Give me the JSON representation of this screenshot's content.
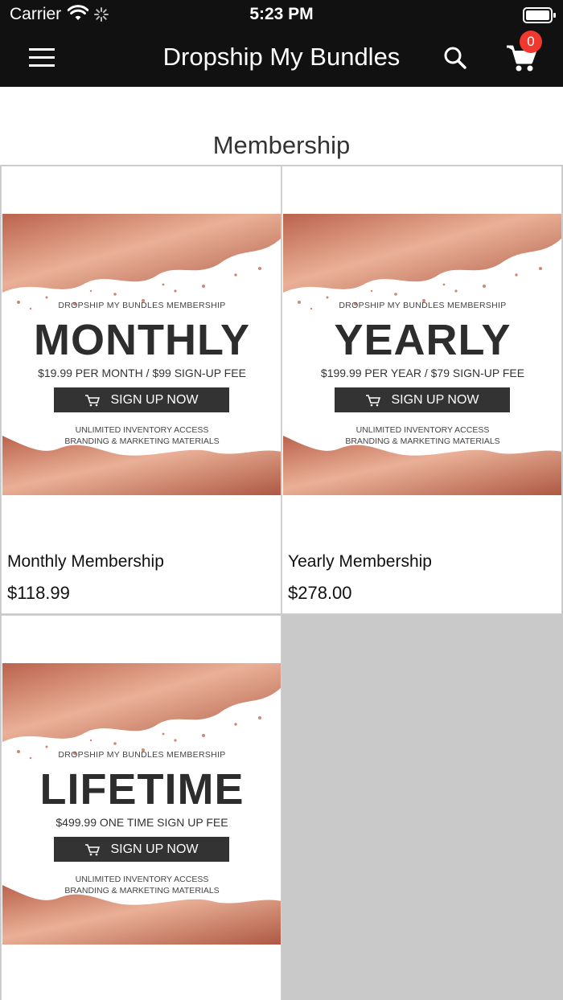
{
  "status_bar": {
    "carrier": "Carrier",
    "time": "5:23 PM"
  },
  "navbar": {
    "title": "Dropship My Bundles",
    "cart_count": "0",
    "icons": [
      "menu-icon",
      "search-icon",
      "cart-icon"
    ],
    "badge_color": "#f0382f"
  },
  "section": {
    "title": "Membership"
  },
  "products": [
    {
      "banner_subtitle": "DROPSHIP MY BUNDLES MEMBERSHIP",
      "banner_title": "MONTHLY",
      "banner_price": "$19.99 PER MONTH  / $99 SIGN-UP FEE",
      "banner_button": "SIGN UP NOW",
      "banner_feature_1": "UNLIMITED INVENTORY ACCESS",
      "banner_feature_2": "BRANDING & MARKETING MATERIALS",
      "name": "Monthly Membership",
      "price": "$118.99"
    },
    {
      "banner_subtitle": "DROPSHIP MY BUNDLES MEMBERSHIP",
      "banner_title": "YEARLY",
      "banner_price": "$199.99 PER YEAR / $79 SIGN-UP FEE",
      "banner_button": "SIGN UP NOW",
      "banner_feature_1": "UNLIMITED INVENTORY ACCESS",
      "banner_feature_2": "BRANDING & MARKETING MATERIALS",
      "name": "Yearly Membership",
      "price": "$278.00"
    },
    {
      "banner_subtitle": "DROPSHIP MY BUNDLES MEMBERSHIP",
      "banner_title": "LIFETIME",
      "banner_price": "$499.99 ONE TIME SIGN UP FEE",
      "banner_button": "SIGN UP NOW",
      "banner_feature_1": "UNLIMITED INVENTORY ACCESS",
      "banner_feature_2": "BRANDING & MARKETING MATERIALS"
    }
  ],
  "colors": {
    "topbar": "#111111",
    "rose_gold": "#c8745a",
    "button": "#333333",
    "grid_background": "#c9c9c9"
  }
}
